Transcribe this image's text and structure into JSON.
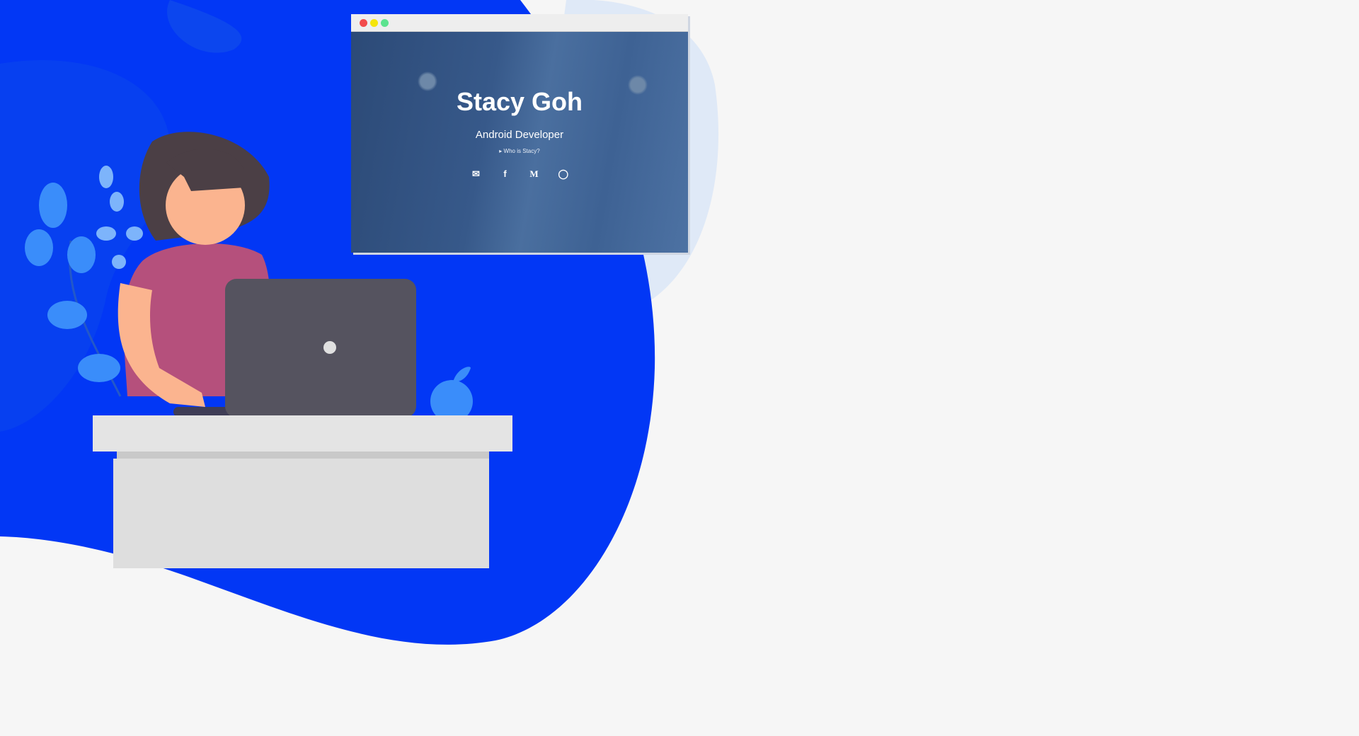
{
  "browser": {
    "window_controls": [
      "close",
      "minimize",
      "maximize"
    ],
    "colors": {
      "close": "#f24b4b",
      "minimize": "#f5e50c",
      "maximize": "#5ce38f"
    },
    "profile": {
      "name": "Stacy Goh",
      "role": "Android Developer",
      "about_link": "Who is Stacy?"
    },
    "social_links": [
      {
        "icon": "mail-icon",
        "glyph": "✉"
      },
      {
        "icon": "facebook-icon",
        "glyph": "f"
      },
      {
        "icon": "medium-icon",
        "glyph": "M"
      },
      {
        "icon": "github-icon",
        "glyph": "◯"
      }
    ]
  },
  "colors": {
    "blob": "#0237f5",
    "background": "#f6f6f6",
    "accent_light": "#dfe9f7"
  }
}
